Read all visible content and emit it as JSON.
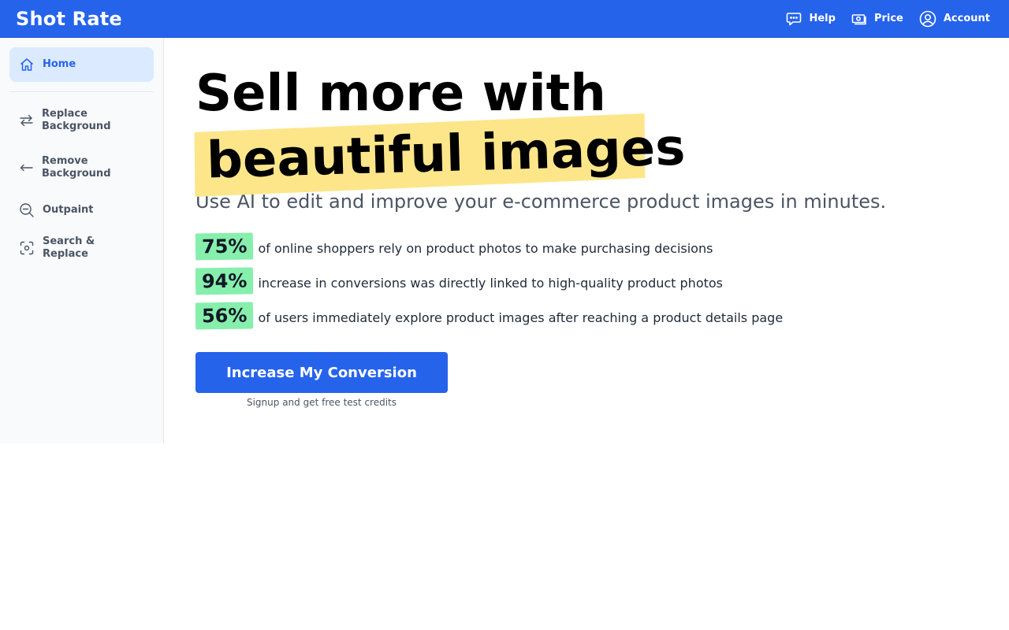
{
  "header": {
    "brand": "Shot Rate",
    "nav": [
      {
        "label": "Help",
        "icon": "chat-bubble-icon"
      },
      {
        "label": "Price",
        "icon": "banknote-icon"
      },
      {
        "label": "Account",
        "icon": "user-circle-icon"
      }
    ]
  },
  "sidebar": {
    "items": [
      {
        "label": "Home",
        "icon": "home-icon",
        "active": true
      },
      {
        "label": "Replace Background",
        "icon": "swap-arrows-icon"
      },
      {
        "label": "Remove Background",
        "icon": "arrow-left-icon"
      },
      {
        "label": "Outpaint",
        "icon": "zoom-out-icon"
      },
      {
        "label": "Search & Replace",
        "icon": "scan-focus-icon"
      }
    ]
  },
  "hero": {
    "headline_line1": "Sell more with",
    "headline_highlight": "beautiful images",
    "subtitle": "Use AI to edit and improve your e-commerce product images in minutes."
  },
  "stats": [
    {
      "value": "75%",
      "text": "of online shoppers rely on product photos to make purchasing decisions"
    },
    {
      "value": "94%",
      "text": "increase in conversions was directly linked to high-quality product photos"
    },
    {
      "value": "56%",
      "text": "of users immediately explore product images after reaching a product details page"
    }
  ],
  "cta": {
    "button_label": "Increase My Conversion",
    "note": "Signup and get free test credits"
  },
  "colors": {
    "primary": "#2563eb",
    "highlight": "#fde68a",
    "stat_badge": "#86efac",
    "sidebar_active_bg": "#dbeafe"
  }
}
